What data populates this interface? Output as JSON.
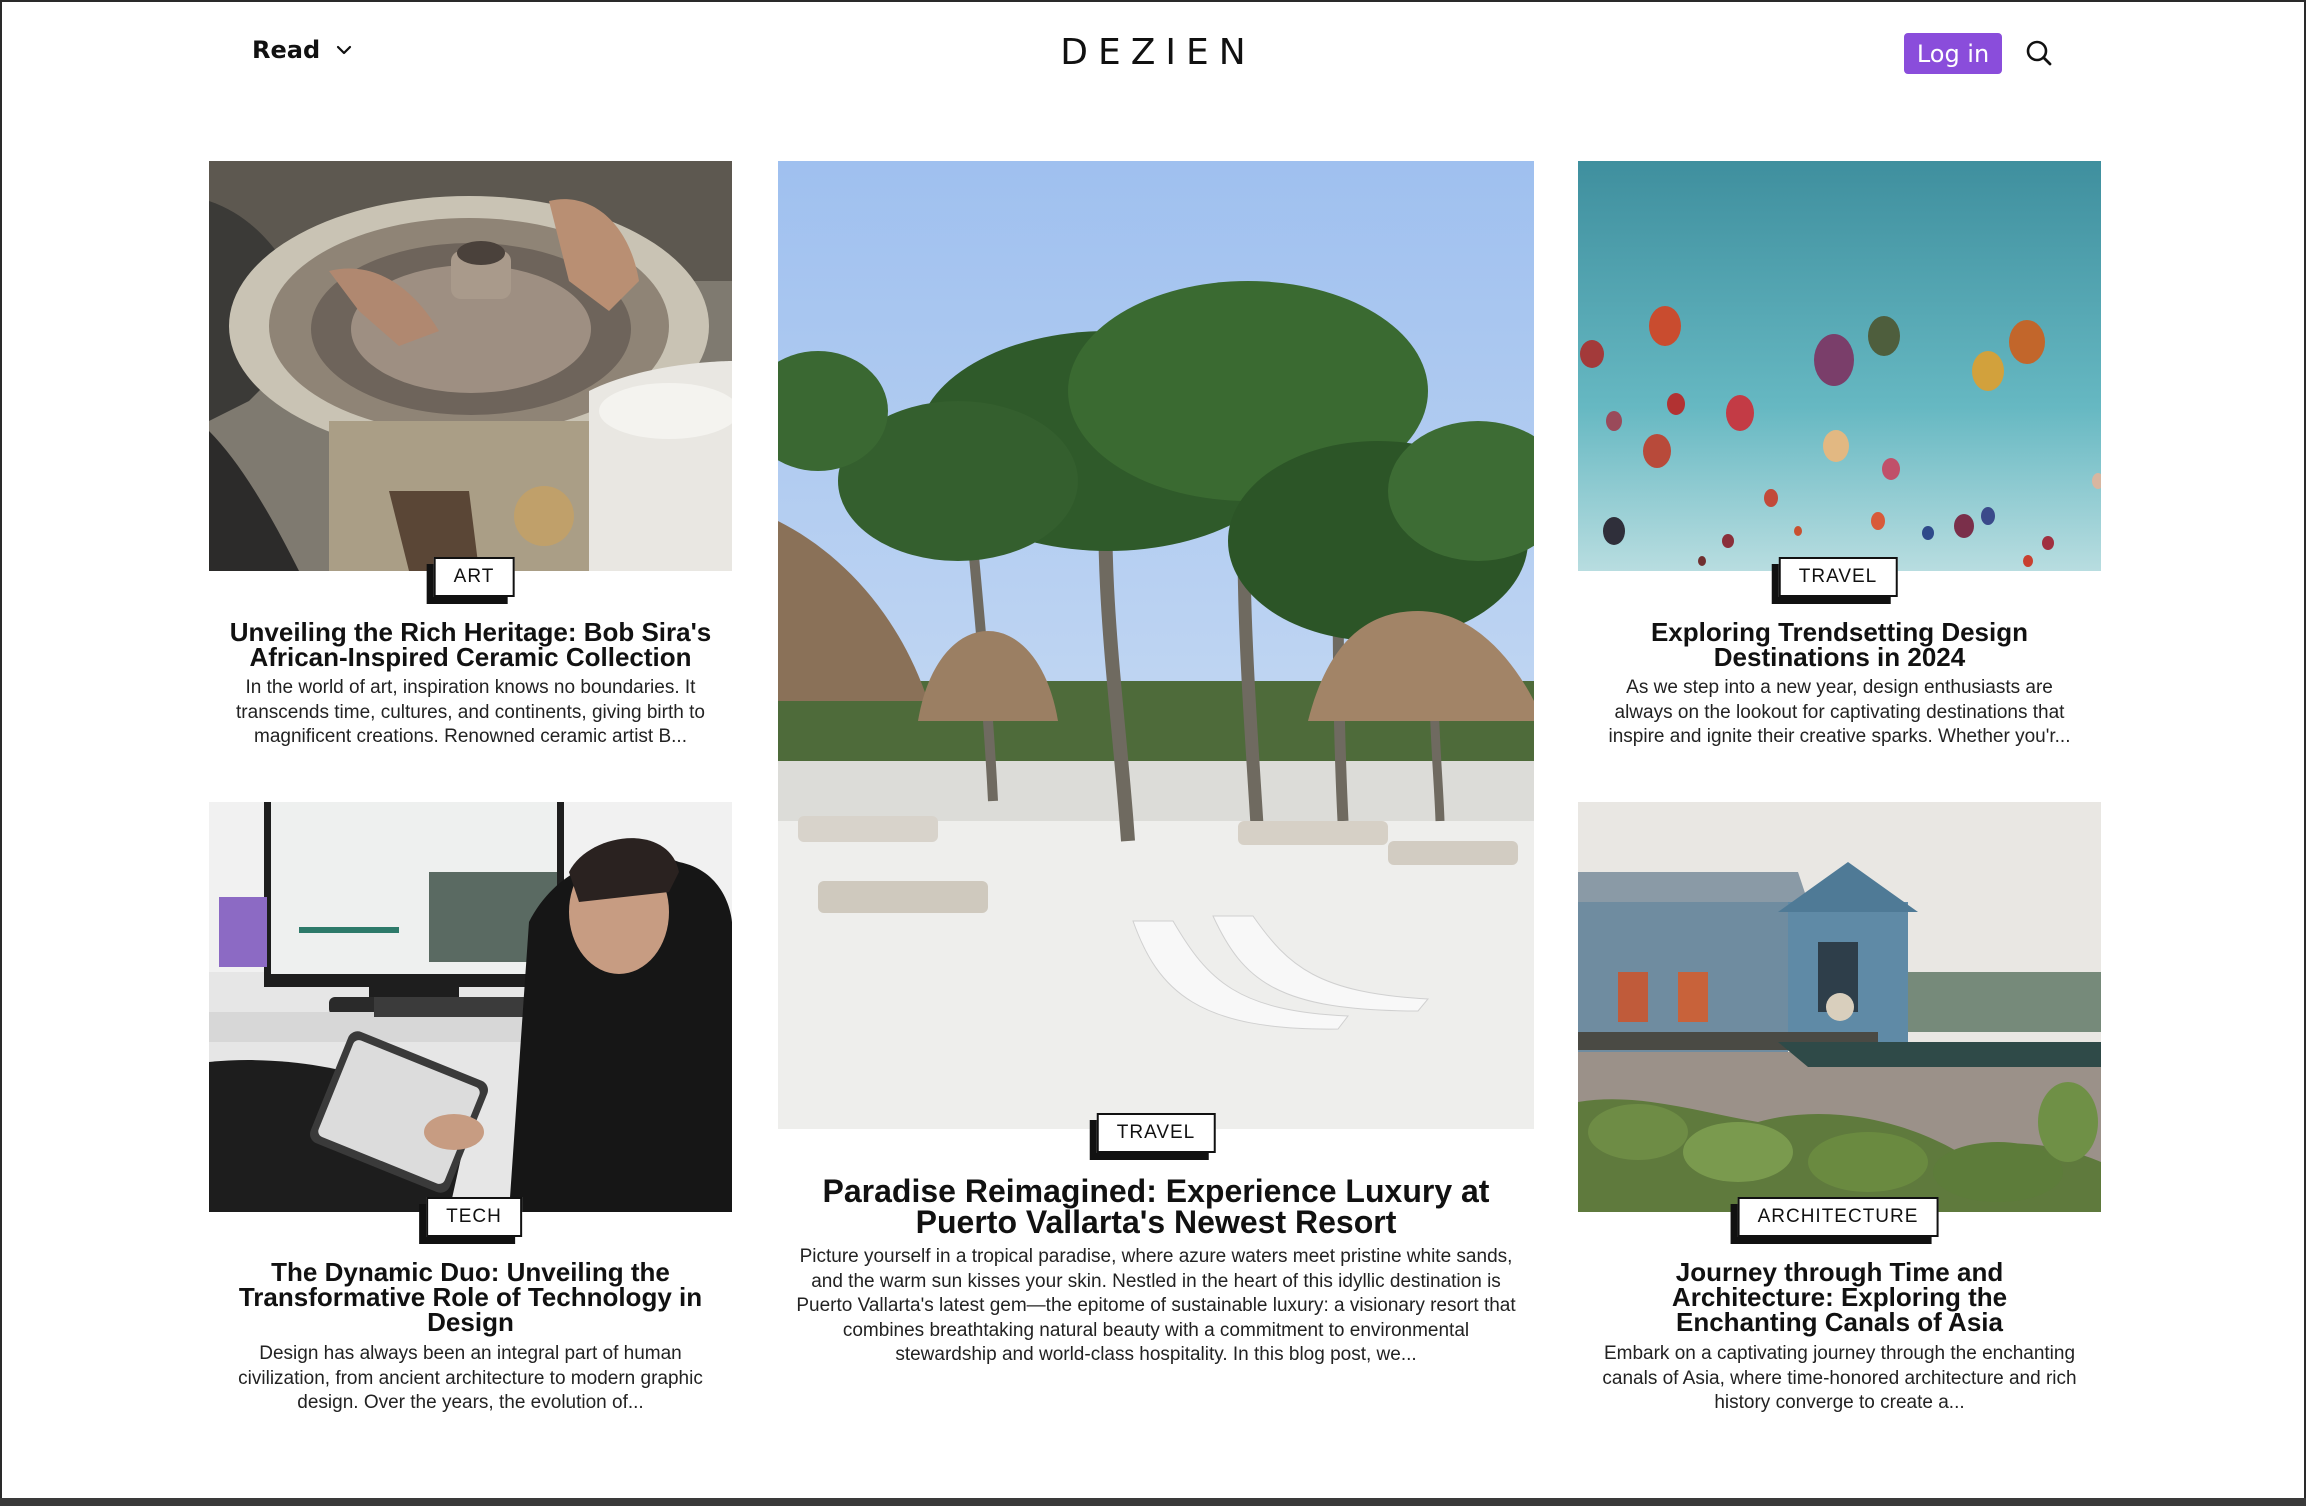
{
  "header": {
    "menu_label": "Read",
    "logo": "DEZIEN",
    "login_label": "Log in"
  },
  "cards": {
    "art": {
      "tag": "ART",
      "title": "Unveiling the Rich Heritage: Bob Sira's African-Inspired Ceramic Collection",
      "excerpt": "In the world of art, inspiration knows no boundaries. It transcends time, cultures, and continents, giving birth to magnificent creations. Renowned ceramic artist B..."
    },
    "resort": {
      "tag": "TRAVEL",
      "title": "Paradise Reimagined: Experience Luxury at Puerto Vallarta's Newest Resort",
      "excerpt": "Picture yourself in a tropical paradise, where azure waters meet pristine white sands, and the warm sun kisses your skin. Nestled in the heart of this idyllic destination is Puerto Vallarta's latest gem—the epitome of sustainable luxury: a visionary resort that combines breathtaking natural beauty with a commitment to environmental stewardship and world-class hospitality. In this blog post, we..."
    },
    "balloons": {
      "tag": "TRAVEL",
      "title": "Exploring Trendsetting Design Destinations in 2024",
      "excerpt": "As we step into a new year, design enthusiasts are always on the lookout for captivating destinations that inspire and ignite their creative sparks. Whether you'r..."
    },
    "tech": {
      "tag": "TECH",
      "title": "The Dynamic Duo: Unveiling the Transformative Role of Technology in Design",
      "excerpt": "Design has always been an integral part of human civilization, from ancient architecture to modern graphic design. Over the years, the evolution of..."
    },
    "canals": {
      "tag": "ARCHITECTURE",
      "title": "Journey through Time and Architecture: Exploring the Enchanting Canals of Asia",
      "excerpt": "Embark on a captivating journey through the enchanting canals of Asia, where time-honored architecture and rich history converge to create a..."
    }
  },
  "colors": {
    "accent": "#8a4ddb",
    "text": "#111111",
    "background": "#ffffff"
  },
  "icons": {
    "menu_chevron": "chevron-down-icon",
    "search": "search-icon"
  }
}
